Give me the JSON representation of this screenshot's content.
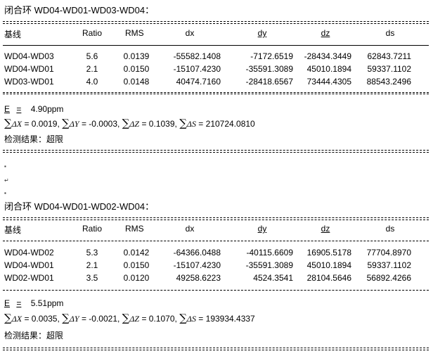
{
  "loops": [
    {
      "title": "闭合环 WD04-WD01-WD03-WD04：",
      "headers": [
        "基线",
        "Ratio",
        "RMS",
        "dx",
        "dy",
        "dz",
        "ds"
      ],
      "rows": [
        [
          "WD04-WD03",
          "5.6",
          "0.0139",
          "-55582.1408",
          "-7172.6519",
          "-28434.3449",
          "62843.7211"
        ],
        [
          "WD04-WD01",
          "2.1",
          "0.0150",
          "-15107.4230",
          "-35591.3089",
          "45010.1894",
          "59337.1102"
        ],
        [
          "WD03-WD01",
          "4.0",
          "0.0148",
          "40474.7160",
          "-28418.6567",
          "73444.4305",
          "88543.2496"
        ]
      ],
      "e_label": "E",
      "e_eq": "=",
      "e_value": "4.90ppm",
      "sums": {
        "dx_label": "ΔX",
        "dx": "= 0.0019,",
        "dy_label": "ΔY",
        "dy": "= -0.0003,",
        "dz_label": "ΔZ",
        "dz": "= 0.1039,",
        "ds_label": "ΔS",
        "ds": "= 210724.0810"
      },
      "result": "检测结果：超限"
    },
    {
      "title": "闭合环 WD04-WD01-WD02-WD04：",
      "headers": [
        "基线",
        "Ratio",
        "RMS",
        "dx",
        "dy",
        "dz",
        "ds"
      ],
      "rows": [
        [
          "WD04-WD02",
          "5.3",
          "0.0142",
          "-64366.0488",
          "-40115.6609",
          "16905.5178",
          "77704.8970"
        ],
        [
          "WD04-WD01",
          "2.1",
          "0.0150",
          "-15107.4230",
          "-35591.3089",
          "45010.1894",
          "59337.1102"
        ],
        [
          "WD02-WD01",
          "3.5",
          "0.0120",
          "49258.6223",
          "4524.3541",
          "28104.5646",
          "56892.4266"
        ]
      ],
      "e_label": "E",
      "e_eq": "=",
      "e_value": "5.51ppm",
      "sums": {
        "dx_label": "ΔX",
        "dx": "= 0.0035,",
        "dy_label": "ΔY",
        "dy": "= -0.0021,",
        "dz_label": "ΔZ",
        "dz": "= 0.1070,",
        "ds_label": "ΔS",
        "ds": "= 193934.4337"
      },
      "result": "检测结果：超限"
    }
  ],
  "symbols": {
    "sum": "∑"
  }
}
